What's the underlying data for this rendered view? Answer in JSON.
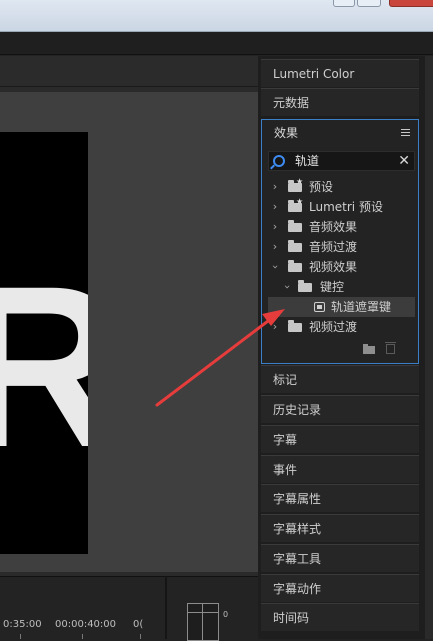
{
  "monitor": {
    "video_text": "R"
  },
  "timeline": {
    "timecode_left": "0:35:00",
    "timecode_mid": "00:00:40:00",
    "timecode_right": "0(",
    "meter_label": "0"
  },
  "panels": {
    "lumetri": "Lumetri Color",
    "metadata": "元数据",
    "markers": "标记",
    "history": "历史记录",
    "captions": "字幕",
    "events": "事件",
    "title_properties": "字幕属性",
    "title_styles": "字幕样式",
    "title_tools": "字幕工具",
    "title_actions": "字幕动作",
    "timecode": "时间码"
  },
  "effects": {
    "title": "效果",
    "search_value": "轨道",
    "tree": [
      {
        "label": "预设"
      },
      {
        "label": "Lumetri 预设"
      },
      {
        "label": "音频效果"
      },
      {
        "label": "音频过渡"
      },
      {
        "label": "视频效果"
      },
      {
        "label": "键控"
      },
      {
        "label": "轨道遮罩键"
      },
      {
        "label": "视频过渡"
      }
    ]
  },
  "colors": {
    "accent": "#3b7fc9",
    "arrow": "#e63c3c"
  }
}
